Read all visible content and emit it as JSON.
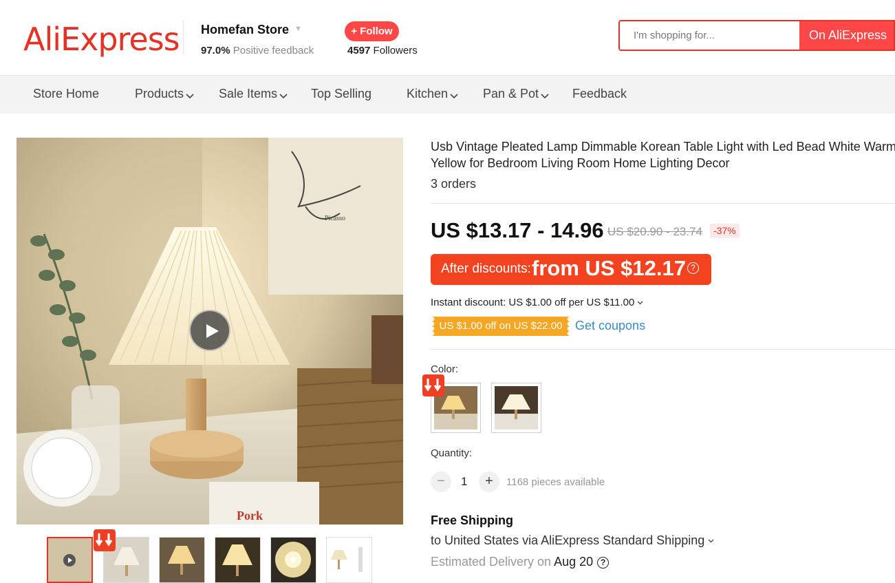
{
  "header": {
    "logo_text": "AliExpress",
    "store_name": "Homefan Store",
    "feedback_percent": "97.0%",
    "feedback_label": "Positive feedback",
    "follow_label": "+ Follow",
    "followers_count": "4597",
    "followers_label": "Followers",
    "search_placeholder": "I'm shopping for...",
    "search_button": "On AliExpress"
  },
  "nav": {
    "items": [
      {
        "label": "Store Home",
        "dropdown": false
      },
      {
        "label": "Products",
        "dropdown": true
      },
      {
        "label": "Sale Items",
        "dropdown": true
      },
      {
        "label": "Top Selling",
        "dropdown": false
      },
      {
        "label": "Kitchen",
        "dropdown": true
      },
      {
        "label": "Pan & Pot",
        "dropdown": true
      },
      {
        "label": "Feedback",
        "dropdown": false
      }
    ]
  },
  "product": {
    "title_line1": "Usb Vintage Pleated Lamp Dimmable Korean Table Light with Led Bead White Warm",
    "title_line2": "Yellow for Bedroom Living Room Home Lighting Decor",
    "orders": "3 orders",
    "price": "US $13.17 - 14.96",
    "old_price": "US $20.90 - 23.74",
    "discount": "-37%",
    "after_label": "After discounts:",
    "after_value": "from US $12.17",
    "after_help": "?",
    "instant_discount": "Instant discount: US $1.00 off per US $11.00",
    "coupon": "US $1.00 off on US $22.00",
    "get_coupons": "Get coupons",
    "color_label": "Color:",
    "quantity_label": "Quantity:",
    "quantity_minus": "−",
    "quantity_value": "1",
    "quantity_plus": "+",
    "available": "1168 pieces available",
    "shipping_title": "Free Shipping",
    "shipping_to": "to United States via AliExpress Standard Shipping",
    "estimated_label": "Estimated Delivery on",
    "estimated_date": "Aug 20",
    "estimated_help": "?"
  },
  "colors": {
    "brand_red": "#e43225",
    "accent_red": "#ff4747",
    "coupon_orange": "#f5a623",
    "link_blue": "#3a8ac4"
  }
}
